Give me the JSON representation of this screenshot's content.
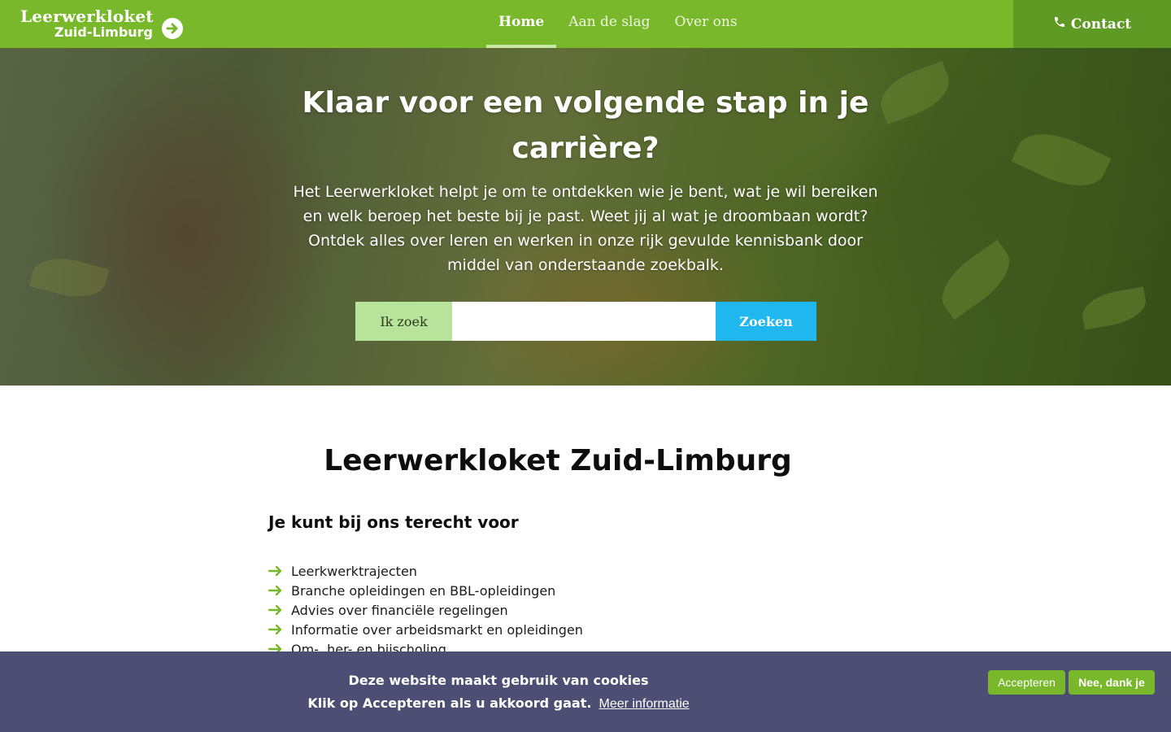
{
  "header": {
    "logo_line1": "Leerwerkloket",
    "logo_line2": "Zuid-Limburg",
    "nav": [
      {
        "label": "Home",
        "active": true
      },
      {
        "label": "Aan de slag",
        "active": false
      },
      {
        "label": "Over ons",
        "active": false
      }
    ],
    "contact_label": "Contact"
  },
  "hero": {
    "title": "Klaar voor een volgende stap in je carrière?",
    "text": "Het Leerwerkloket helpt je om te ontdekken wie je bent, wat je wil bereiken en welk beroep het beste bij je past. Weet jij al wat je droombaan wordt? Ontdek alles over leren en werken in onze rijk gevulde kennisbank door middel van onderstaande zoekbalk.",
    "search": {
      "label": "Ik zoek",
      "value": "",
      "button": "Zoeken"
    }
  },
  "main": {
    "title": "Leerwerkloket Zuid-Limburg",
    "section_heading": "Je kunt bij ons terecht voor",
    "services": [
      "Leerkwerktrajecten",
      "Branche opleidingen en BBL-opleidingen",
      "Advies over financiële regelingen",
      "Informatie over arbeidsmarkt en opleidingen",
      "Om-, her- en bijscholing"
    ]
  },
  "cookie": {
    "title": "Deze website maakt gebruik van cookies",
    "message": "Klik op Accepteren als u akkoord gaat.",
    "more_link": "Meer informatie",
    "accept": "Accepteren",
    "decline": "Nee, dank je"
  },
  "colors": {
    "brand_green": "#79b82b",
    "contact_green": "#5f9a24",
    "search_blue": "#20b7ef",
    "cookie_bg": "#4c4f73"
  },
  "icons": {
    "logo_arrow": "arrow-right-circle-icon",
    "contact": "phone-icon",
    "list_bullet": "arrow-right-icon"
  }
}
